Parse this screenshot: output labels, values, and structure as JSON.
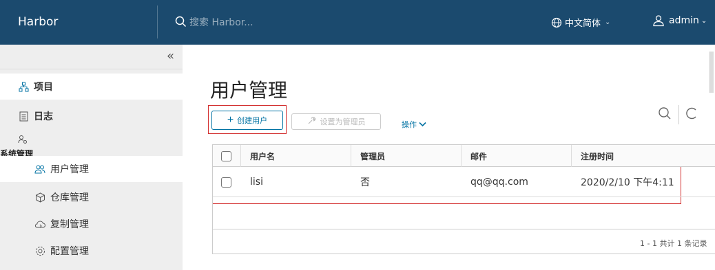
{
  "header": {
    "brand": "Harbor",
    "search_placeholder": "搜索 Harbor...",
    "language": "中文简体",
    "user": "admin",
    "bg_color": "#1b4a6e"
  },
  "sidebar": {
    "collapse_glyph": "«",
    "items": [
      {
        "label": "项目",
        "icon": "project-icon"
      },
      {
        "label": "日志",
        "icon": "log-icon"
      }
    ],
    "group_label": "系统管理",
    "sub_items": [
      {
        "label": "用户管理",
        "icon": "users-icon"
      },
      {
        "label": "仓库管理",
        "icon": "registry-icon"
      },
      {
        "label": "复制管理",
        "icon": "replication-icon"
      },
      {
        "label": "配置管理",
        "icon": "config-icon"
      }
    ]
  },
  "main": {
    "title": "用户管理",
    "create_button": "创建用户",
    "set_admin_button": "设置为管理员",
    "actions_label": "操作",
    "table": {
      "columns": [
        "用户名",
        "管理员",
        "邮件",
        "注册时间"
      ],
      "rows": [
        {
          "username": "lisi",
          "admin": "否",
          "email": "qq@qq.com",
          "registered": "2020/2/10 下午4:11"
        }
      ],
      "footer": "1 - 1 共计 1 条记录"
    }
  },
  "colors": {
    "accent": "#0072a3",
    "highlight": "#d32f2f"
  }
}
